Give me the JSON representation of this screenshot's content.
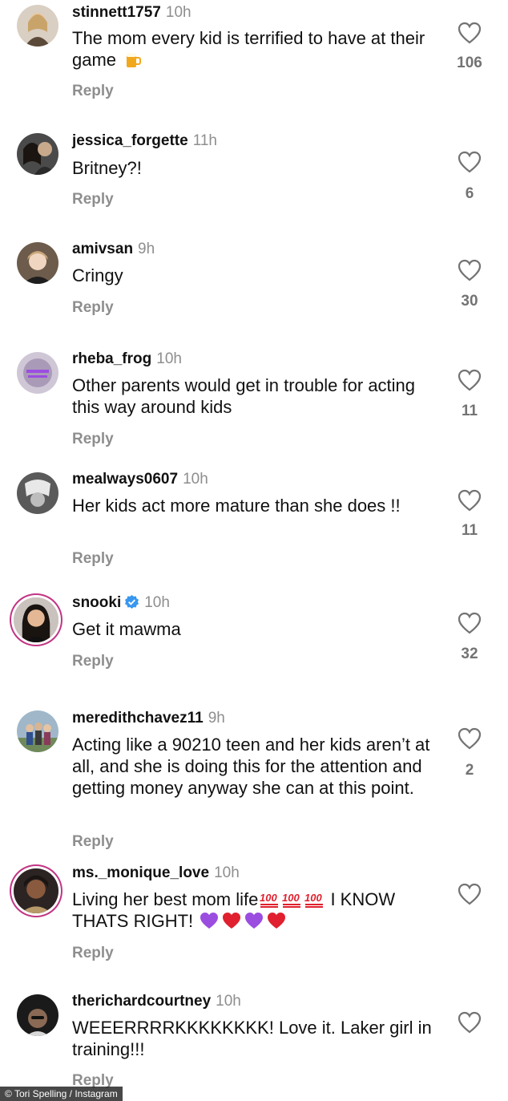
{
  "comments": [
    {
      "username": "stinnett1757",
      "time": "10h",
      "text": "The mom every kid is terrified to have at their game",
      "emoji": "beer-mug",
      "reply": "Reply",
      "likes": "106"
    },
    {
      "username": "jessica_forgette",
      "time": "11h",
      "text": "Britney?!",
      "reply": "Reply",
      "likes": "6"
    },
    {
      "username": "amivsan",
      "time": "9h",
      "text": "Cringy",
      "reply": "Reply",
      "likes": "30"
    },
    {
      "username": "rheba_frog",
      "time": "10h",
      "text": "Other parents would get in trouble for acting this way around kids",
      "reply": "Reply",
      "likes": "11"
    },
    {
      "username": "mealways0607",
      "time": "10h",
      "text": "Her kids act more mature than she does !!",
      "reply": "Reply",
      "likes": "11"
    },
    {
      "username": "snooki",
      "verified": true,
      "time": "10h",
      "text": "Get it mawma",
      "reply": "Reply",
      "likes": "32"
    },
    {
      "username": "meredithchavez11",
      "time": "9h",
      "text": "Acting like a 90210 teen and her kids aren’t at all,  and she is doing this for the attention and getting  money anyway she can at this point.",
      "reply": "Reply",
      "likes": "2"
    },
    {
      "username": "ms._monique_love",
      "time": "10h",
      "text_a": "Living her best mom life",
      "text_b": " I KNOW THATS RIGHT! ",
      "emojis": [
        "hundred-points",
        "hundred-points",
        "hundred-points",
        "purple-heart",
        "red-heart",
        "purple-heart",
        "red-heart"
      ],
      "reply": "Reply",
      "likes": ""
    },
    {
      "username": "therichardcourtney",
      "time": "10h",
      "text": "WEEERRRRKKKKKKKK!  Love it.  Laker girl in training!!!",
      "reply": "Reply",
      "likes": ""
    }
  ],
  "credit": "© Tori Spelling / Instagram",
  "colors": {
    "accent_ring": "#c13584",
    "verified": "#3897f0",
    "heart_red": "#e0202e",
    "heart_purple": "#9b4de0",
    "hundred_red": "#e0202e"
  }
}
